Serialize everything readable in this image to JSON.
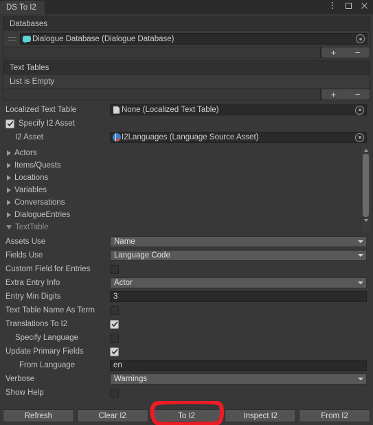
{
  "window": {
    "tab_label": "DS To I2",
    "controls": [
      {
        "name": "more-menu",
        "glyph": "⋮"
      },
      {
        "name": "maximize",
        "glyph": "□"
      },
      {
        "name": "close",
        "glyph": "✕"
      }
    ]
  },
  "databases": {
    "header": "Databases",
    "items": [
      {
        "label": "Dialogue Database (Dialogue Database)",
        "icon": "dialogue-database-icon"
      }
    ],
    "add_label": "+",
    "remove_label": "−"
  },
  "text_tables": {
    "header": "Text Tables",
    "empty_label": "List is Empty",
    "add_label": "+",
    "remove_label": "−"
  },
  "fields": {
    "localized_text_table": {
      "label": "Localized Text Table",
      "value": "None (Localized Text Table)"
    },
    "specify_i2_asset": {
      "label": "Specify I2 Asset",
      "checked": true
    },
    "i2_asset": {
      "label": "I2 Asset",
      "value": "I2Languages (Language Source Asset)"
    }
  },
  "foldouts": [
    {
      "label": "Actors",
      "expanded": false
    },
    {
      "label": "Items/Quests",
      "expanded": false
    },
    {
      "label": "Locations",
      "expanded": false
    },
    {
      "label": "Variables",
      "expanded": false
    },
    {
      "label": "Conversations",
      "expanded": false
    },
    {
      "label": "DialogueEntries",
      "expanded": false
    },
    {
      "label": "TextTable",
      "expanded": true
    }
  ],
  "settings": [
    {
      "label": "Assets Use",
      "type": "dropdown",
      "value": "Name"
    },
    {
      "label": "Fields Use",
      "type": "dropdown",
      "value": "Language Code"
    },
    {
      "label": "Custom Field for Entries",
      "type": "checkbox",
      "checked": false
    },
    {
      "label": "Extra Entry Info",
      "type": "dropdown",
      "value": "Actor"
    },
    {
      "label": "Entry Min Digits",
      "type": "text",
      "value": "3"
    },
    {
      "label": "Text Table Name As Term",
      "type": "checkbox",
      "checked": false
    },
    {
      "label": "Translations To I2",
      "type": "checkbox",
      "checked": true
    },
    {
      "label": "Specify Language",
      "type": "checkbox",
      "checked": false,
      "indent": 1
    },
    {
      "label": "Update Primary Fields",
      "type": "checkbox",
      "checked": true
    },
    {
      "label": "From Language",
      "type": "text",
      "value": "en",
      "indent": 1
    },
    {
      "label": "Verbose",
      "type": "dropdown",
      "value": "Warnings"
    },
    {
      "label": "Show Help",
      "type": "checkbox",
      "checked": false
    }
  ],
  "buttons": [
    {
      "label": "Refresh",
      "highlighted": false
    },
    {
      "label": "Clear I2",
      "highlighted": false
    },
    {
      "label": "To I2",
      "highlighted": true
    },
    {
      "label": "Inspect I2",
      "highlighted": false
    },
    {
      "label": "From I2",
      "highlighted": false
    }
  ],
  "annotation": {
    "color": "#ed1c24",
    "shape": "hand-drawn-rectangle",
    "target": "To I2"
  }
}
